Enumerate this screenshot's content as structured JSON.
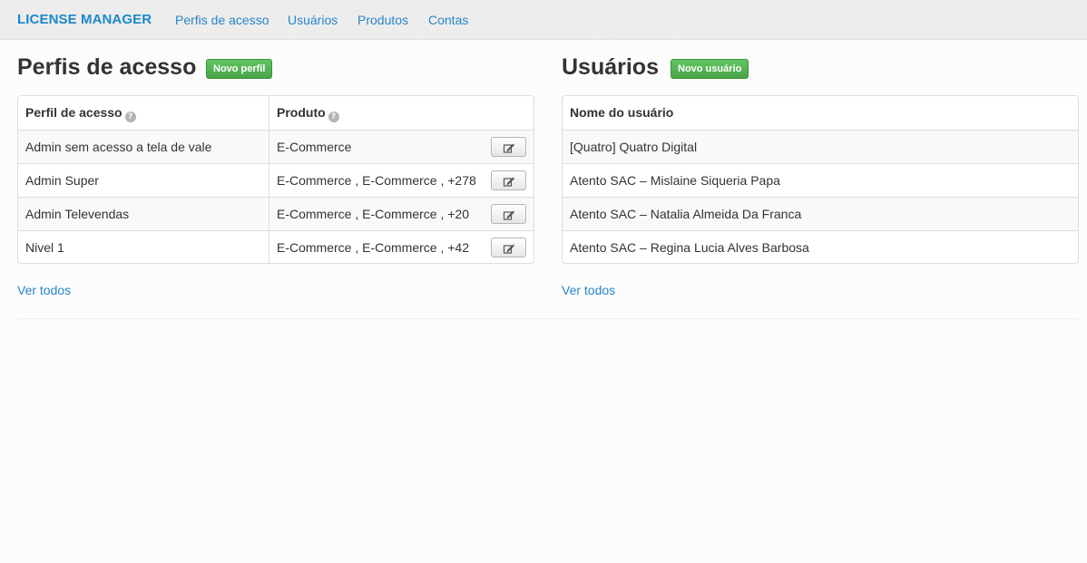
{
  "navbar": {
    "brand": "LICENSE MANAGER",
    "links": [
      "Perfis de acesso",
      "Usuários",
      "Produtos",
      "Contas"
    ]
  },
  "profiles": {
    "title": "Perfis de acesso",
    "new_button": "Novo perfil",
    "columns": [
      "Perfil de acesso",
      "Produto"
    ],
    "rows": [
      {
        "name": "Admin sem acesso a tela de vale",
        "product": "E-Commerce"
      },
      {
        "name": "Admin Super",
        "product": "E-Commerce , E-Commerce , +278"
      },
      {
        "name": "Admin Televendas",
        "product": "E-Commerce , E-Commerce , +20"
      },
      {
        "name": "Nivel 1",
        "product": "E-Commerce , E-Commerce , +42"
      }
    ],
    "see_all": "Ver todos"
  },
  "users": {
    "title": "Usuários",
    "new_button": "Novo usuário",
    "columns": [
      "Nome do usuário"
    ],
    "rows": [
      "[Quatro] Quatro Digital",
      "Atento SAC – Mislaine Siqueria Papa",
      "Atento SAC – Natalia Almeida Da Franca",
      "Atento SAC – Regina Lucia Alves Barbosa"
    ],
    "see_all": "Ver todos"
  },
  "colors": {
    "brand": "#1b87c9",
    "link": "#2a85c7",
    "success": "#5cb85c"
  },
  "icons": {
    "help": "question-circle-icon",
    "edit": "edit-pencil-icon"
  }
}
